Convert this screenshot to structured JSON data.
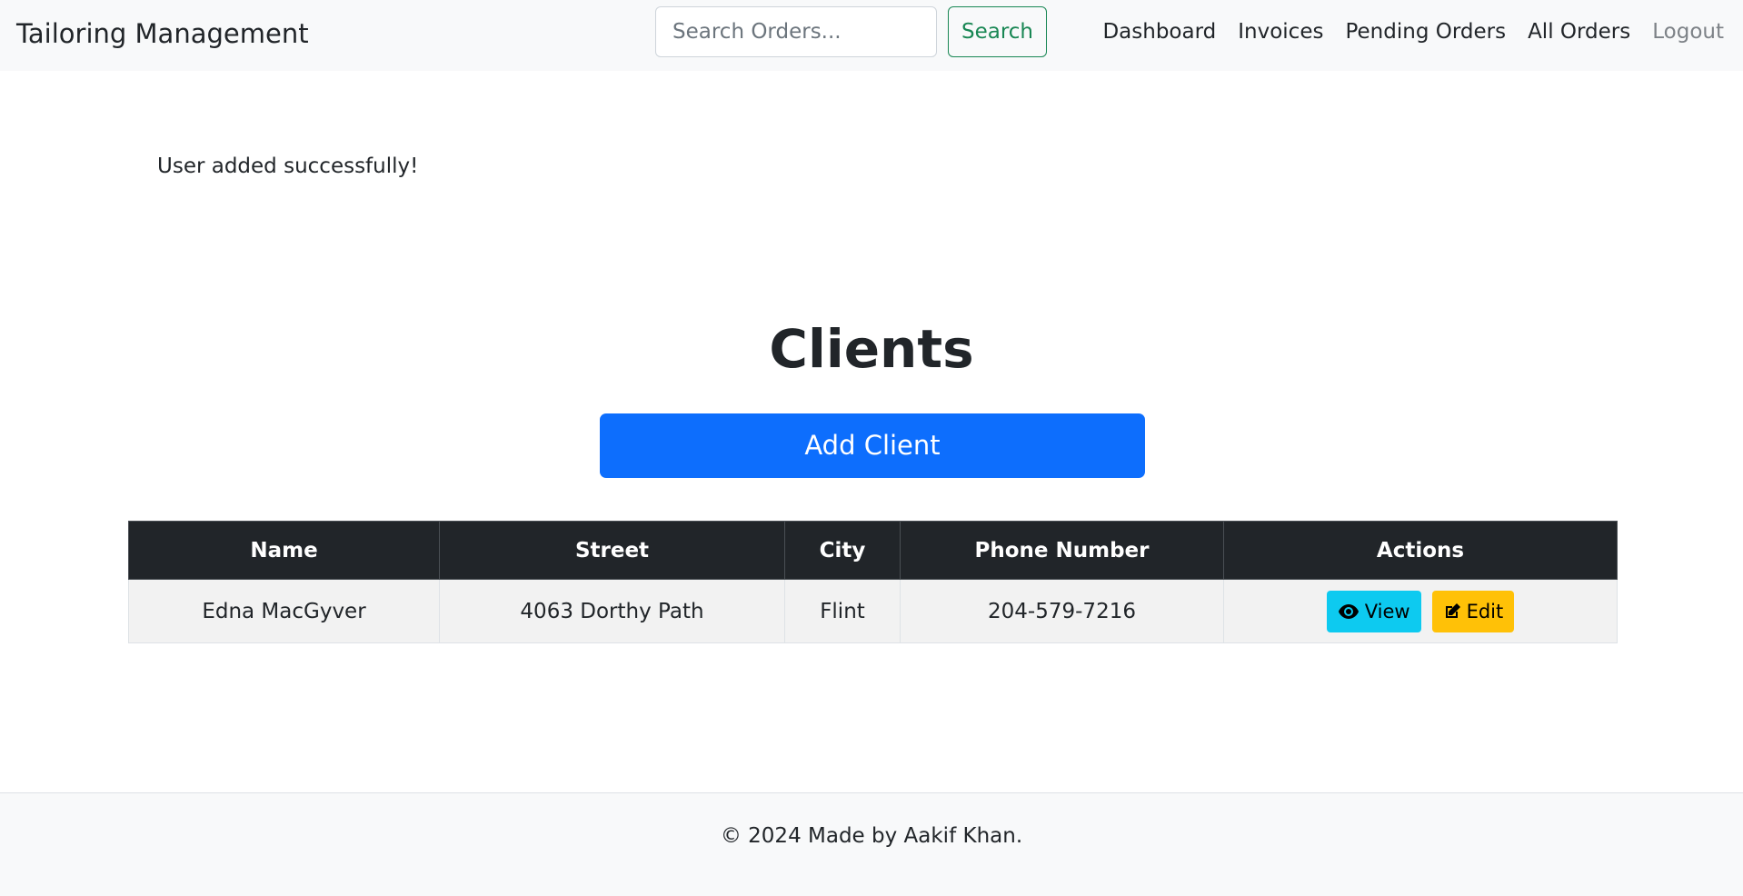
{
  "navbar": {
    "brand": "Tailoring Management",
    "search": {
      "placeholder": "Search Orders...",
      "value": "",
      "button_label": "Search"
    },
    "links": [
      {
        "label": "Dashboard"
      },
      {
        "label": "Invoices"
      },
      {
        "label": "Pending Orders"
      },
      {
        "label": "All Orders"
      },
      {
        "label": "Logout"
      }
    ]
  },
  "alert": {
    "message": "User added successfully!"
  },
  "main": {
    "title": "Clients",
    "add_button_label": "Add Client"
  },
  "table": {
    "headers": [
      "Name",
      "Street",
      "City",
      "Phone Number",
      "Actions"
    ],
    "rows": [
      {
        "name": "Edna MacGyver",
        "street": "4063 Dorthy Path",
        "city": "Flint",
        "phone": "204-579-7216",
        "actions": [
          {
            "label": "View",
            "icon": "eye-icon"
          },
          {
            "label": "Edit",
            "icon": "edit-icon"
          }
        ]
      }
    ]
  },
  "footer": {
    "text": "© 2024 Made by Aakif Khan."
  },
  "colors": {
    "primary": "#0d6efd",
    "success": "#198754",
    "info": "#0dcaf0",
    "warning": "#ffc107",
    "dark": "#212529",
    "navbar_bg": "#f8f9fa"
  }
}
